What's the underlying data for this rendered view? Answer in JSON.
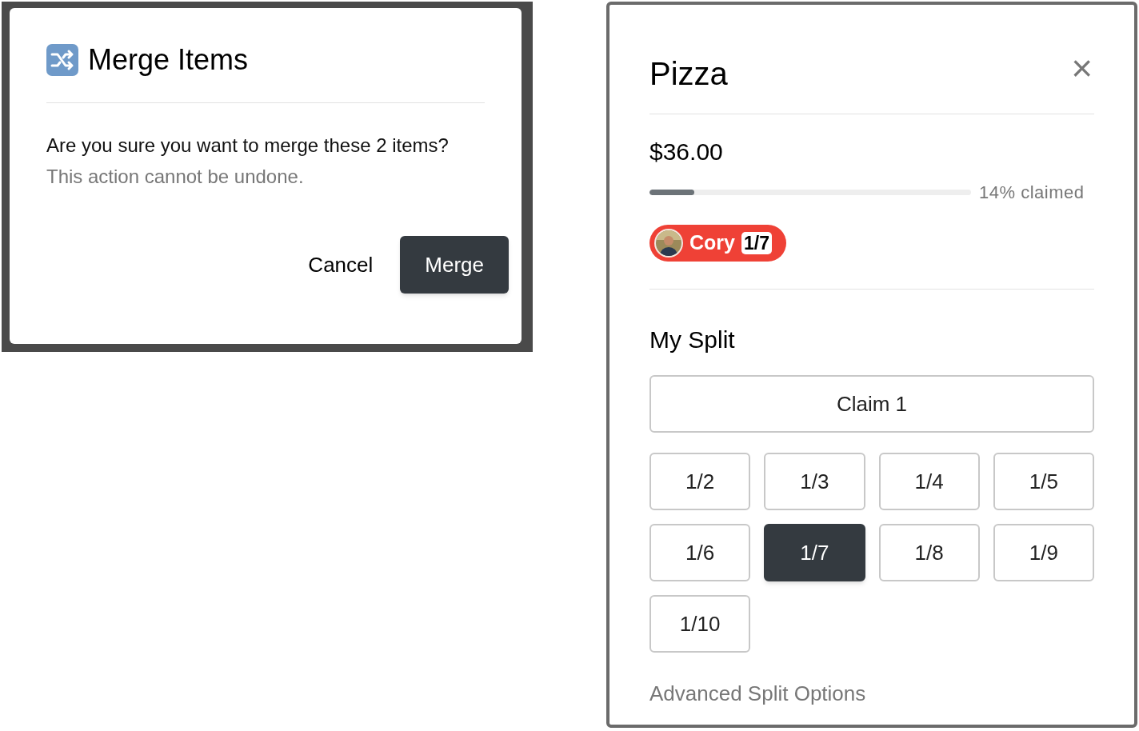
{
  "merge_dialog": {
    "title": "Merge Items",
    "message": "Are you sure you want to merge these 2 items?",
    "note": "This action cannot be undone.",
    "buttons": [
      {
        "label": "Cancel",
        "kind": "text"
      },
      {
        "label": "Merge",
        "kind": "primary"
      }
    ]
  },
  "item_dialog": {
    "title": "Pizza",
    "close": "×",
    "price": "$36.00",
    "progress": {
      "level": 0.14,
      "reading": "14% claimed"
    },
    "claims": [
      {
        "name": "Cory",
        "share": "1/7",
        "color": "#ef4136"
      }
    ],
    "split_heading": "My Split",
    "claim_button": "Claim 1",
    "fractions": [
      {
        "label": "1/2",
        "selected": false
      },
      {
        "label": "1/3",
        "selected": false
      },
      {
        "label": "1/4",
        "selected": false
      },
      {
        "label": "1/5",
        "selected": false
      },
      {
        "label": "1/6",
        "selected": false
      },
      {
        "label": "1/7",
        "selected": true
      },
      {
        "label": "1/8",
        "selected": false
      },
      {
        "label": "1/9",
        "selected": false
      },
      {
        "label": "1/10",
        "selected": false
      }
    ],
    "advanced_link": "Advanced Split Options"
  }
}
